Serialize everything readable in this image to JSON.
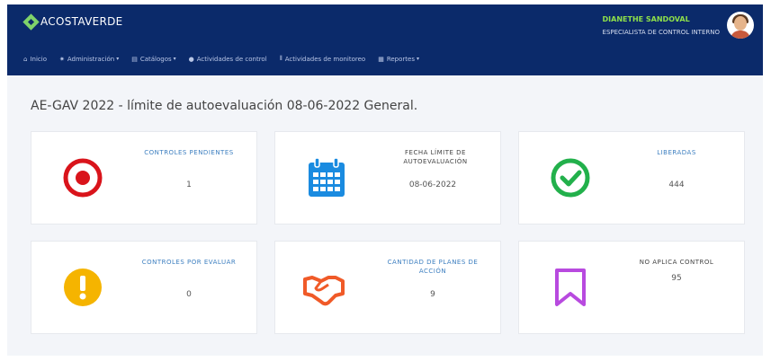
{
  "brand": {
    "name": "ACOSTAVERDE"
  },
  "user": {
    "name": "DIANETHE SANDOVAL",
    "role": "ESPECIALISTA DE CONTROL INTERNO"
  },
  "menu": [
    {
      "icon": "⌂",
      "label": "Inicio",
      "caret": ""
    },
    {
      "icon": "✷",
      "label": "Administración",
      "caret": "▾"
    },
    {
      "icon": "▤",
      "label": "Catálogos",
      "caret": "▾"
    },
    {
      "icon": "●",
      "label": "Actividades de control",
      "caret": ""
    },
    {
      "icon": "⦀",
      "label": "Actividades de monitoreo",
      "caret": ""
    },
    {
      "icon": "▦",
      "label": "Reportes",
      "caret": "▾"
    }
  ],
  "page": {
    "title": "AE-GAV 2022 - límite de autoevaluación 08-06-2022 General."
  },
  "cards": [
    {
      "label": "CONTROLES PENDIENTES",
      "value": "1",
      "icon": "target-icon"
    },
    {
      "label": "FECHA LÍMITE DE AUTOEVALUACIÓN",
      "value": "08-06-2022",
      "icon": "calendar-icon"
    },
    {
      "label": "LIBERADAS",
      "value": "444",
      "icon": "check-circle-icon"
    },
    {
      "label": "CONTROLES POR EVALUAR",
      "value": "0",
      "icon": "exclamation-circle-icon"
    },
    {
      "label": "CANTIDAD DE PLANES DE ACCIÓN",
      "value": "9",
      "icon": "handshake-icon"
    },
    {
      "label": "NO APLICA CONTROL",
      "value": "95",
      "icon": "bookmark-icon"
    }
  ],
  "colors": {
    "navbar": "#0b2a6a",
    "accent_green": "#8ee04a",
    "target_red": "#d9141b",
    "calendar_blue": "#1a8be0",
    "check_green": "#22b04b",
    "warning_yellow": "#f5b400",
    "handshake_orange": "#f05a28",
    "bookmark_purple": "#b84adf"
  }
}
